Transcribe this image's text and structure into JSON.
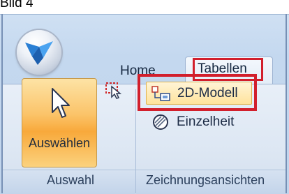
{
  "caption": "Bild 4",
  "tabs": [
    {
      "label": "Home"
    },
    {
      "label": "Tabellen"
    }
  ],
  "groups": {
    "auswahl": {
      "label": "Auswahl",
      "select_button_label": "Auswählen"
    },
    "zeichnungsansichten": {
      "label": "Zeichnungsansichten",
      "model_2d_label": "2D-Modell",
      "detail_label": "Einzelheit"
    }
  },
  "icons": {
    "orb": "app-menu-icon",
    "select": "cursor-arrow-icon",
    "select_tool": "selection-tool-icon",
    "model_2d": "2d-model-icon",
    "detail": "detail-view-icon"
  },
  "colors": {
    "highlight": "#d21f2c",
    "active_button": "#f8a93b"
  }
}
